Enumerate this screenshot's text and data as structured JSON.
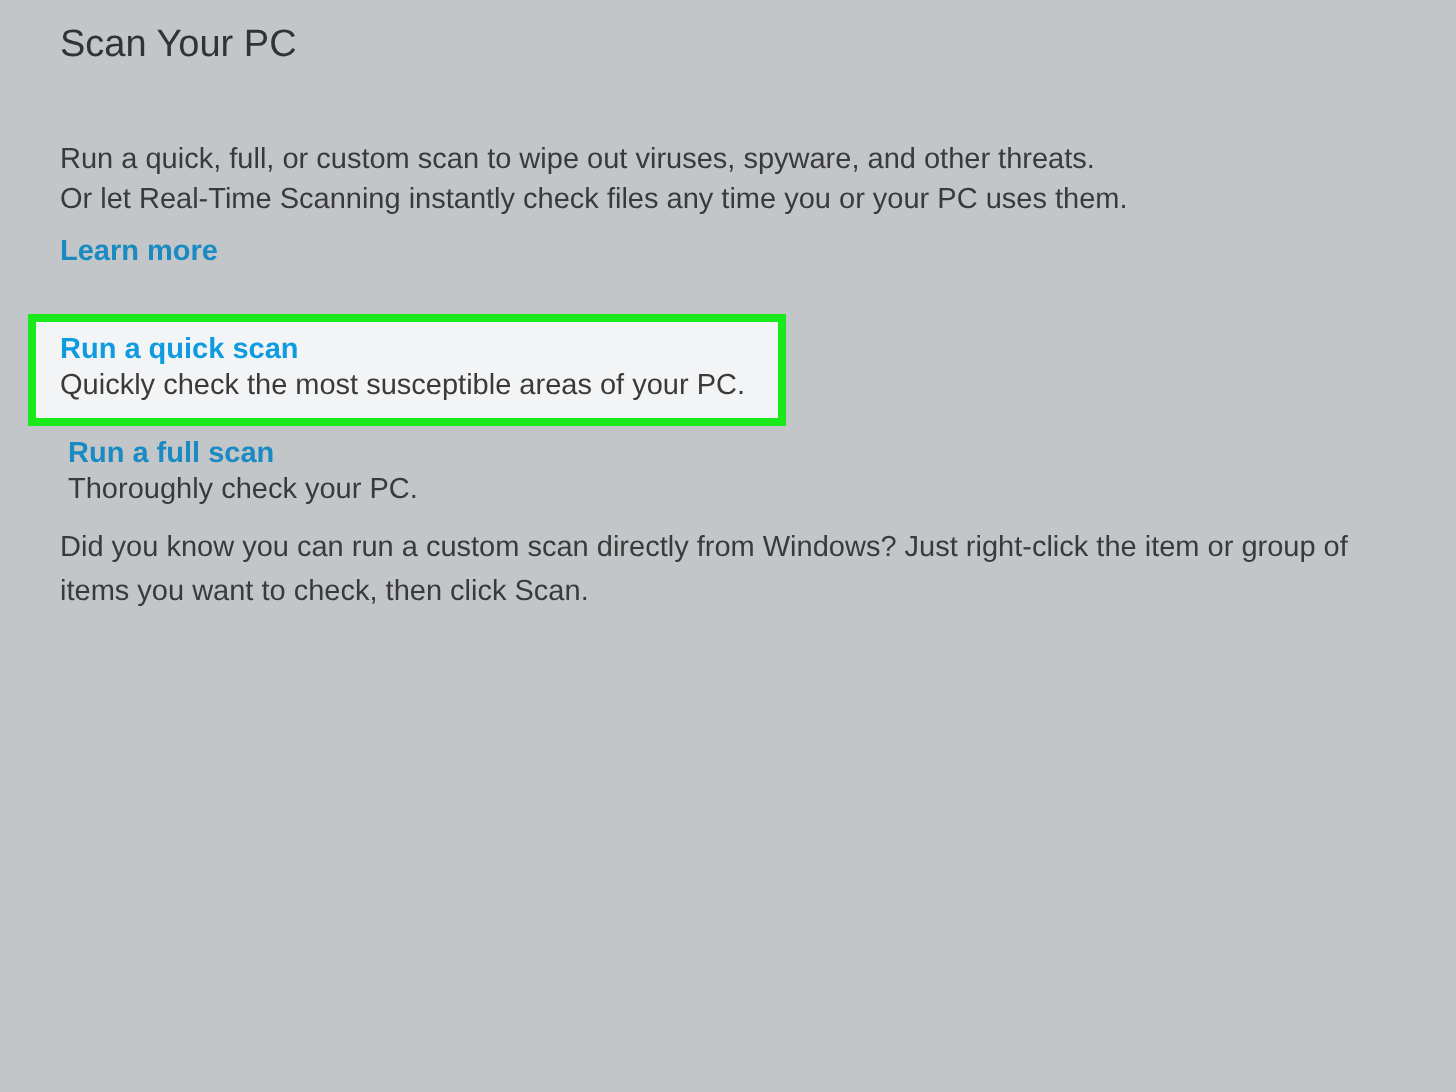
{
  "title": "Scan Your PC",
  "description": [
    "Run a quick, full, or custom scan to wipe out viruses, spyware, and other threats.",
    "Or let Real-Time Scanning instantly check files any time you or your PC uses them."
  ],
  "learn_more": "Learn more",
  "scan_options": [
    {
      "label": "Run a quick scan",
      "detail": "Quickly check the most susceptible areas of your PC.",
      "highlighted": true
    },
    {
      "label": "Run a full scan",
      "detail": "Thoroughly check your PC.",
      "highlighted": false
    }
  ],
  "tip": "Did you know you can run a custom scan directly from Windows? Just right-click the item or group of items you want to check, then click Scan."
}
